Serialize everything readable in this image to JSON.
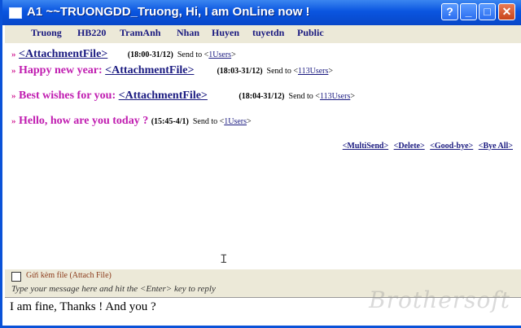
{
  "window": {
    "title": "A1 ~~TRUONGDD_Truong, Hi, I am OnLine now ! ",
    "buttons": {
      "help": "?",
      "minimize": "_",
      "maximize": "□",
      "close": "✕"
    }
  },
  "tabs": [
    "Truong",
    "HB220",
    "TramAnh",
    "Nhan",
    "Huyen",
    "tuyetdn",
    "Public"
  ],
  "messages": [
    {
      "arrow": "»",
      "text": "",
      "attachment": "<AttachmentFile>",
      "time": "(18:00-31/12)",
      "send_to": "Send to <",
      "users": "1Users",
      "close": ">"
    },
    {
      "arrow": "»",
      "text": "Happy new year: ",
      "attachment": "<AttachmentFile>",
      "time": "(18:03-31/12)",
      "send_to": "Send to <",
      "users": "113Users",
      "close": ">"
    },
    {
      "arrow": "»",
      "text": "Best wishes for you: ",
      "attachment": "<AttachmentFile>",
      "time": "(18:04-31/12)",
      "send_to": "Send to <",
      "users": "113Users",
      "close": ">"
    },
    {
      "arrow": "»",
      "text": "Hello, how are you today ? ",
      "attachment": "",
      "time": "(15:45-4/1)",
      "send_to": "Send to <",
      "users": "1Users",
      "close": ">"
    }
  ],
  "actions": [
    "<MultiSend>",
    "<Delete>",
    "<Good-bye>",
    "<Bye All>"
  ],
  "attach_file": {
    "checked": false,
    "label": "Gửi kèm file (Attach File)"
  },
  "hint": "Type your message here and hit the <Enter> key to reply",
  "input": {
    "value": "I am fine, Thanks ! And you ?"
  },
  "watermark": "Brothersoft"
}
